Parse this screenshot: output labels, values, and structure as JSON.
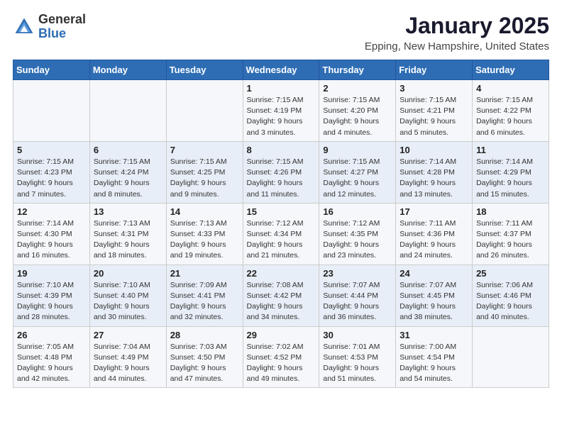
{
  "header": {
    "logo_general": "General",
    "logo_blue": "Blue",
    "month_title": "January 2025",
    "location": "Epping, New Hampshire, United States"
  },
  "weekdays": [
    "Sunday",
    "Monday",
    "Tuesday",
    "Wednesday",
    "Thursday",
    "Friday",
    "Saturday"
  ],
  "weeks": [
    [
      {
        "day": "",
        "info": ""
      },
      {
        "day": "",
        "info": ""
      },
      {
        "day": "",
        "info": ""
      },
      {
        "day": "1",
        "info": "Sunrise: 7:15 AM\nSunset: 4:19 PM\nDaylight: 9 hours\nand 3 minutes."
      },
      {
        "day": "2",
        "info": "Sunrise: 7:15 AM\nSunset: 4:20 PM\nDaylight: 9 hours\nand 4 minutes."
      },
      {
        "day": "3",
        "info": "Sunrise: 7:15 AM\nSunset: 4:21 PM\nDaylight: 9 hours\nand 5 minutes."
      },
      {
        "day": "4",
        "info": "Sunrise: 7:15 AM\nSunset: 4:22 PM\nDaylight: 9 hours\nand 6 minutes."
      }
    ],
    [
      {
        "day": "5",
        "info": "Sunrise: 7:15 AM\nSunset: 4:23 PM\nDaylight: 9 hours\nand 7 minutes."
      },
      {
        "day": "6",
        "info": "Sunrise: 7:15 AM\nSunset: 4:24 PM\nDaylight: 9 hours\nand 8 minutes."
      },
      {
        "day": "7",
        "info": "Sunrise: 7:15 AM\nSunset: 4:25 PM\nDaylight: 9 hours\nand 9 minutes."
      },
      {
        "day": "8",
        "info": "Sunrise: 7:15 AM\nSunset: 4:26 PM\nDaylight: 9 hours\nand 11 minutes."
      },
      {
        "day": "9",
        "info": "Sunrise: 7:15 AM\nSunset: 4:27 PM\nDaylight: 9 hours\nand 12 minutes."
      },
      {
        "day": "10",
        "info": "Sunrise: 7:14 AM\nSunset: 4:28 PM\nDaylight: 9 hours\nand 13 minutes."
      },
      {
        "day": "11",
        "info": "Sunrise: 7:14 AM\nSunset: 4:29 PM\nDaylight: 9 hours\nand 15 minutes."
      }
    ],
    [
      {
        "day": "12",
        "info": "Sunrise: 7:14 AM\nSunset: 4:30 PM\nDaylight: 9 hours\nand 16 minutes."
      },
      {
        "day": "13",
        "info": "Sunrise: 7:13 AM\nSunset: 4:31 PM\nDaylight: 9 hours\nand 18 minutes."
      },
      {
        "day": "14",
        "info": "Sunrise: 7:13 AM\nSunset: 4:33 PM\nDaylight: 9 hours\nand 19 minutes."
      },
      {
        "day": "15",
        "info": "Sunrise: 7:12 AM\nSunset: 4:34 PM\nDaylight: 9 hours\nand 21 minutes."
      },
      {
        "day": "16",
        "info": "Sunrise: 7:12 AM\nSunset: 4:35 PM\nDaylight: 9 hours\nand 23 minutes."
      },
      {
        "day": "17",
        "info": "Sunrise: 7:11 AM\nSunset: 4:36 PM\nDaylight: 9 hours\nand 24 minutes."
      },
      {
        "day": "18",
        "info": "Sunrise: 7:11 AM\nSunset: 4:37 PM\nDaylight: 9 hours\nand 26 minutes."
      }
    ],
    [
      {
        "day": "19",
        "info": "Sunrise: 7:10 AM\nSunset: 4:39 PM\nDaylight: 9 hours\nand 28 minutes."
      },
      {
        "day": "20",
        "info": "Sunrise: 7:10 AM\nSunset: 4:40 PM\nDaylight: 9 hours\nand 30 minutes."
      },
      {
        "day": "21",
        "info": "Sunrise: 7:09 AM\nSunset: 4:41 PM\nDaylight: 9 hours\nand 32 minutes."
      },
      {
        "day": "22",
        "info": "Sunrise: 7:08 AM\nSunset: 4:42 PM\nDaylight: 9 hours\nand 34 minutes."
      },
      {
        "day": "23",
        "info": "Sunrise: 7:07 AM\nSunset: 4:44 PM\nDaylight: 9 hours\nand 36 minutes."
      },
      {
        "day": "24",
        "info": "Sunrise: 7:07 AM\nSunset: 4:45 PM\nDaylight: 9 hours\nand 38 minutes."
      },
      {
        "day": "25",
        "info": "Sunrise: 7:06 AM\nSunset: 4:46 PM\nDaylight: 9 hours\nand 40 minutes."
      }
    ],
    [
      {
        "day": "26",
        "info": "Sunrise: 7:05 AM\nSunset: 4:48 PM\nDaylight: 9 hours\nand 42 minutes."
      },
      {
        "day": "27",
        "info": "Sunrise: 7:04 AM\nSunset: 4:49 PM\nDaylight: 9 hours\nand 44 minutes."
      },
      {
        "day": "28",
        "info": "Sunrise: 7:03 AM\nSunset: 4:50 PM\nDaylight: 9 hours\nand 47 minutes."
      },
      {
        "day": "29",
        "info": "Sunrise: 7:02 AM\nSunset: 4:52 PM\nDaylight: 9 hours\nand 49 minutes."
      },
      {
        "day": "30",
        "info": "Sunrise: 7:01 AM\nSunset: 4:53 PM\nDaylight: 9 hours\nand 51 minutes."
      },
      {
        "day": "31",
        "info": "Sunrise: 7:00 AM\nSunset: 4:54 PM\nDaylight: 9 hours\nand 54 minutes."
      },
      {
        "day": "",
        "info": ""
      }
    ]
  ]
}
